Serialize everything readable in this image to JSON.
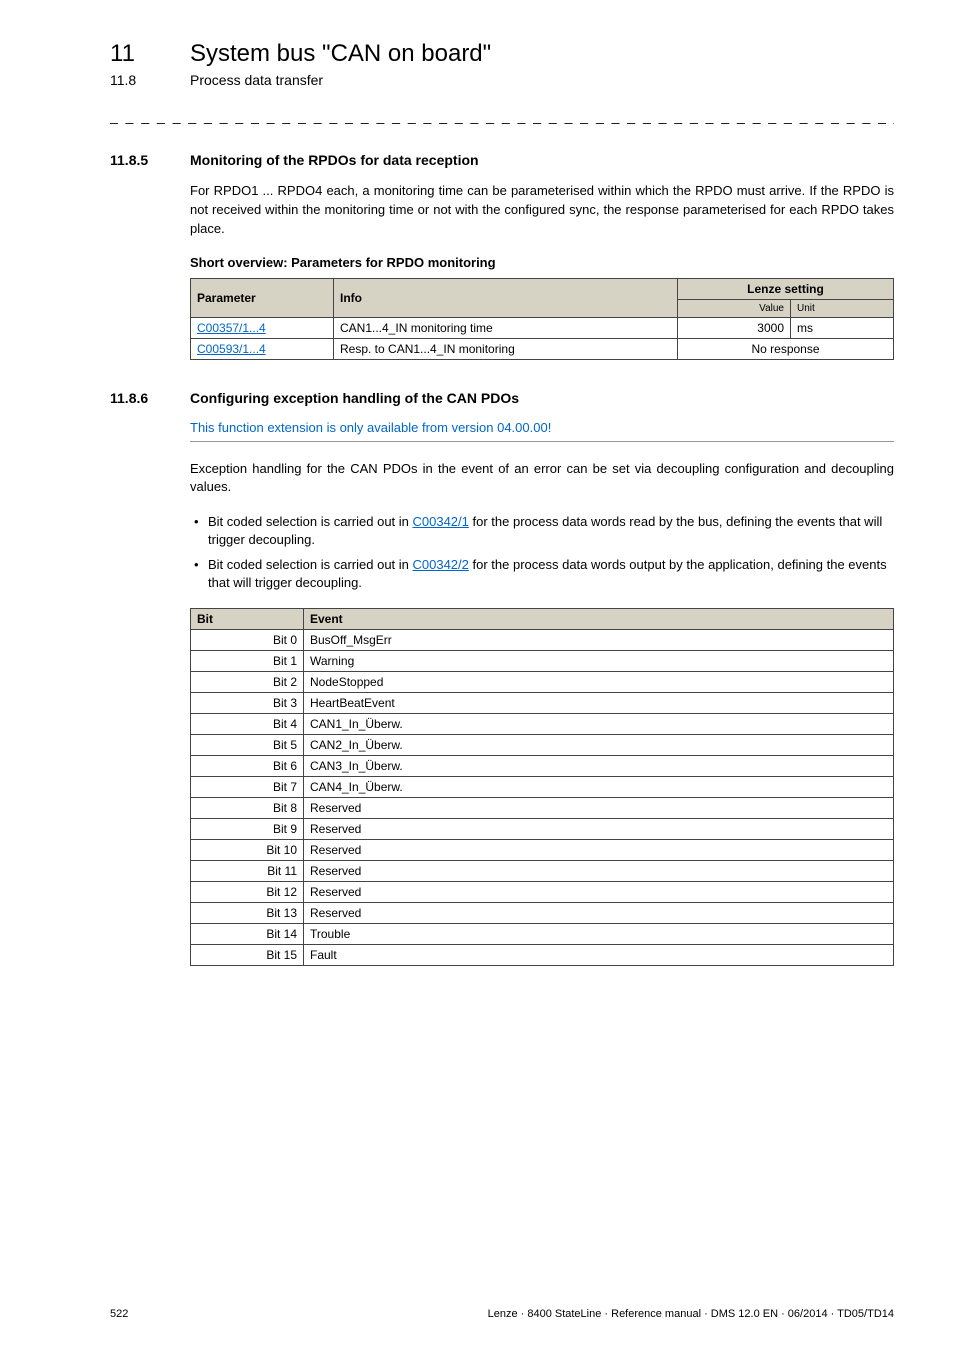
{
  "chapter": {
    "num": "11",
    "title": "System bus \"CAN on board\""
  },
  "subsection": {
    "num": "11.8",
    "title": "Process data transfer"
  },
  "dash_rule": "_ _ _ _ _ _ _ _ _ _ _ _ _ _ _ _ _ _ _ _ _ _ _ _ _ _ _ _ _ _ _ _ _ _ _ _ _ _ _ _ _ _ _ _ _ _ _ _ _ _ _ _ _ _ _ _ _ _ _ _ _ _ _ _",
  "section1": {
    "num": "11.8.5",
    "title": "Monitoring of the RPDOs for data reception",
    "para": "For RPDO1 ... RPDO4 each, a monitoring time can be parameterised within which the RPDO must arrive. If the RPDO is not received within the monitoring time or not with the configured sync, the response parameterised for each RPDO takes place.",
    "table_title": "Short overview: Parameters for RPDO monitoring",
    "table": {
      "headers": {
        "param": "Parameter",
        "info": "Info",
        "setting": "Lenze setting",
        "value": "Value",
        "unit": "Unit"
      },
      "rows": [
        {
          "param": "C00357/1...4",
          "info": "CAN1...4_IN monitoring time",
          "value": "3000",
          "unit": "ms",
          "merged": false
        },
        {
          "param": "C00593/1...4",
          "info": "Resp. to CAN1...4_IN monitoring",
          "merged_text": "No response",
          "merged": true
        }
      ]
    }
  },
  "section2": {
    "num": "11.8.6",
    "title": "Configuring exception handling of the CAN PDOs",
    "note": "This function extension is only available from version 04.00.00!",
    "para": "Exception handling for the CAN PDOs in the event of an error can be set via decoupling configuration and decoupling values.",
    "bullets": [
      {
        "pre": "Bit coded selection is carried out in ",
        "link": "C00342/1",
        "post": " for the process data words read by the bus, defining the events that will trigger decoupling."
      },
      {
        "pre": "Bit coded selection is carried out in ",
        "link": "C00342/2",
        "post": " for the process data words output by the application, defining the events that will trigger decoupling."
      }
    ],
    "bit_table": {
      "headers": {
        "bit": "Bit",
        "event": "Event"
      },
      "rows": [
        {
          "bit": "Bit 0 ",
          "event": "BusOff_MsgErr"
        },
        {
          "bit": "Bit 1 ",
          "event": "Warning"
        },
        {
          "bit": "Bit 2 ",
          "event": "NodeStopped"
        },
        {
          "bit": "Bit 3 ",
          "event": "HeartBeatEvent"
        },
        {
          "bit": "Bit 4 ",
          "event": "CAN1_In_Überw."
        },
        {
          "bit": "Bit 5 ",
          "event": "CAN2_In_Überw."
        },
        {
          "bit": "Bit 6 ",
          "event": "CAN3_In_Überw."
        },
        {
          "bit": "Bit 7 ",
          "event": "CAN4_In_Überw."
        },
        {
          "bit": "Bit 8 ",
          "event": "Reserved"
        },
        {
          "bit": "Bit 9 ",
          "event": "Reserved"
        },
        {
          "bit": "Bit 10 ",
          "event": "Reserved"
        },
        {
          "bit": "Bit 11 ",
          "event": "Reserved"
        },
        {
          "bit": "Bit 12 ",
          "event": "Reserved"
        },
        {
          "bit": "Bit 13 ",
          "event": "Reserved"
        },
        {
          "bit": "Bit 14 ",
          "event": "Trouble"
        },
        {
          "bit": "Bit 15 ",
          "event": "Fault"
        }
      ]
    }
  },
  "footer": {
    "page": "522",
    "right": "Lenze · 8400 StateLine · Reference manual · DMS 12.0 EN · 06/2014 · TD05/TD14"
  }
}
